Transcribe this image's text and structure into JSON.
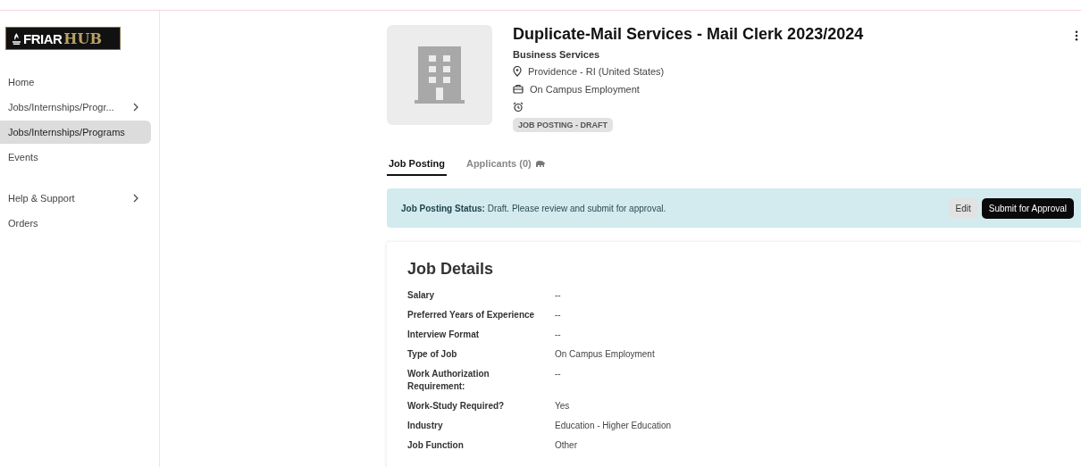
{
  "logo": {
    "part_1": "FRIAR",
    "part_2": "HUB"
  },
  "sidebar": {
    "groups": [
      {
        "items": [
          {
            "label": "Home",
            "selected": false,
            "has_submenu": false
          },
          {
            "label": "Jobs/Internships/Progr...",
            "selected": false,
            "has_submenu": true
          },
          {
            "label": "Jobs/Internships/Programs",
            "selected": true,
            "has_submenu": false
          },
          {
            "label": "Events",
            "selected": false,
            "has_submenu": false
          }
        ]
      },
      {
        "items": [
          {
            "label": "Help & Support",
            "selected": false,
            "has_submenu": true
          },
          {
            "label": "Orders",
            "selected": false,
            "has_submenu": false
          }
        ]
      }
    ]
  },
  "posting": {
    "title": "Duplicate-Mail Services - Mail Clerk 2023/2024",
    "employer": "Business Services",
    "location": "Providence - RI (United States)",
    "job_type": "On Campus Employment",
    "status_badge": "JOB POSTING - DRAFT"
  },
  "tabs": [
    {
      "label": "Job Posting",
      "selected": true
    },
    {
      "label": "Applicants (0)",
      "selected": false
    }
  ],
  "status_banner": {
    "message": "**Job Posting Status:** Draft. Please review and submit for approval.",
    "buttons": [
      {
        "label": "Edit",
        "kind": "secondary"
      },
      {
        "label": "Submit for Approval",
        "kind": "primary"
      }
    ]
  },
  "job_details": {
    "heading": "Job Details",
    "rows": [
      {
        "label": "Salary",
        "value": "--"
      },
      {
        "label": "Preferred Years of Experience",
        "value": "--"
      },
      {
        "label": "Interview Format",
        "value": "--"
      },
      {
        "label": "Type of Job",
        "value": "On Campus Employment"
      },
      {
        "label": "Work Authorization Requirement:",
        "value": "--"
      },
      {
        "label": "Work-Study Required?",
        "value": "Yes"
      },
      {
        "label": "Industry",
        "value": "Education - Higher Education"
      },
      {
        "label": "Job Function",
        "value": "Other"
      }
    ]
  }
}
